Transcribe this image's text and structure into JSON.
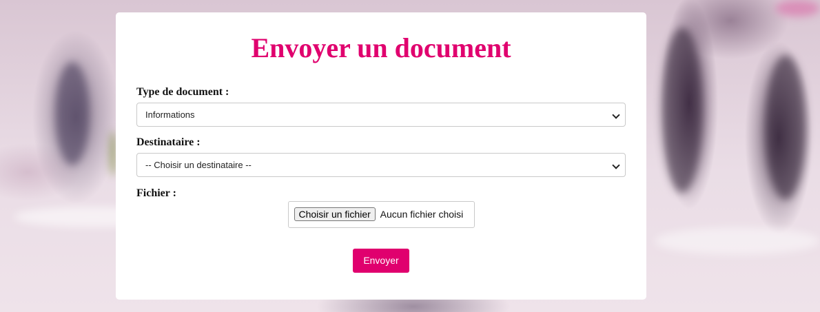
{
  "form": {
    "title": "Envoyer un document",
    "document_type": {
      "label": "Type de document :",
      "selected": "Informations"
    },
    "recipient": {
      "label": "Destinataire :",
      "selected": "-- Choisir un destinataire --"
    },
    "file": {
      "label": "Fichier :",
      "button_label": "Choisir un fichier",
      "status": "Aucun fichier choisi"
    },
    "submit_label": "Envoyer"
  },
  "colors": {
    "accent": "#e0006e",
    "card_background": "#ffffff"
  },
  "icons": {
    "select_arrow": "chevron-down-icon"
  }
}
